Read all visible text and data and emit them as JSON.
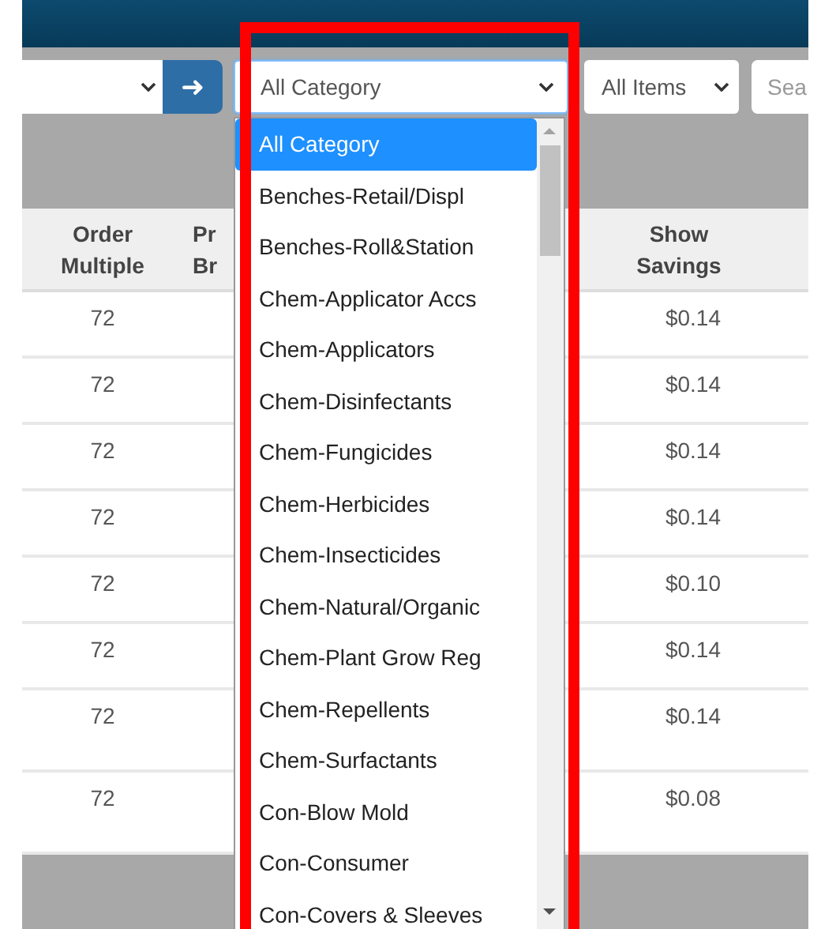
{
  "toolbar": {
    "arrow_button": "➜",
    "category_select": {
      "value": "All Category",
      "expanded": true
    },
    "items_select": {
      "value": "All Items"
    },
    "search": {
      "placeholder": "Sea"
    }
  },
  "table": {
    "columns": [
      "Order Multiple",
      "Pr Br",
      "Show Savings"
    ],
    "rows": [
      {
        "order_multiple": "72",
        "show_savings": "$0.14"
      },
      {
        "order_multiple": "72",
        "show_savings": "$0.14"
      },
      {
        "order_multiple": "72",
        "show_savings": "$0.14"
      },
      {
        "order_multiple": "72",
        "show_savings": "$0.14"
      },
      {
        "order_multiple": "72",
        "show_savings": "$0.10"
      },
      {
        "order_multiple": "72",
        "show_savings": "$0.14"
      },
      {
        "order_multiple": "72",
        "show_savings": "$0.14"
      },
      {
        "order_multiple": "72",
        "show_savings": "$0.08"
      }
    ]
  },
  "category_options": [
    {
      "label": "All Category",
      "selected": true
    },
    {
      "label": "Benches-Retail/Displ",
      "selected": false
    },
    {
      "label": "Benches-Roll&Station",
      "selected": false
    },
    {
      "label": "Chem-Applicator Accs",
      "selected": false
    },
    {
      "label": "Chem-Applicators",
      "selected": false
    },
    {
      "label": "Chem-Disinfectants",
      "selected": false
    },
    {
      "label": "Chem-Fungicides",
      "selected": false
    },
    {
      "label": "Chem-Herbicides",
      "selected": false
    },
    {
      "label": "Chem-Insecticides",
      "selected": false
    },
    {
      "label": "Chem-Natural/Organic",
      "selected": false
    },
    {
      "label": "Chem-Plant Grow Reg",
      "selected": false
    },
    {
      "label": "Chem-Repellents",
      "selected": false
    },
    {
      "label": "Chem-Surfactants",
      "selected": false
    },
    {
      "label": "Con-Blow Mold",
      "selected": false
    },
    {
      "label": "Con-Consumer",
      "selected": false
    },
    {
      "label": "Con-Covers & Sleeves",
      "selected": false
    }
  ],
  "highlight_frame": {
    "color": "#ff0000"
  }
}
